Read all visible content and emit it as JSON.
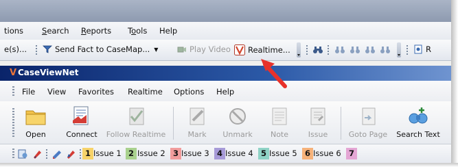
{
  "host": {
    "menu": [
      {
        "label": "tions",
        "u": ""
      },
      {
        "label": "Search",
        "u": "S"
      },
      {
        "label": "Reports",
        "u": "R"
      },
      {
        "label": "Tools",
        "u": "o"
      },
      {
        "label": "Help",
        "u": ""
      }
    ],
    "toolbar": {
      "cut_left": "e(s)...",
      "send_fact": "Send Fact to CaseMap...",
      "play_video": "Play Video",
      "realtime": "Realtime...",
      "cut_right": "R"
    }
  },
  "app": {
    "title": "CaseViewNet",
    "menu": [
      "File",
      "View",
      "Favorites",
      "Realtime",
      "Options",
      "Help"
    ],
    "toolbar": [
      {
        "id": "open",
        "label": "Open",
        "icon": "folder-icon",
        "enabled": true
      },
      {
        "id": "connect",
        "label": "Connect",
        "icon": "connect-icon",
        "enabled": true
      },
      {
        "id": "follow",
        "label": "Follow Realtime",
        "icon": "follow-icon",
        "enabled": false
      },
      {
        "id": "mark",
        "label": "Mark",
        "icon": "mark-icon",
        "enabled": false
      },
      {
        "id": "unmark",
        "label": "Unmark",
        "icon": "unmark-icon",
        "enabled": false
      },
      {
        "id": "note",
        "label": "Note",
        "icon": "note-icon",
        "enabled": false
      },
      {
        "id": "issue",
        "label": "Issue",
        "icon": "issue-icon",
        "enabled": false
      },
      {
        "id": "gotopage",
        "label": "Goto Page",
        "icon": "goto-page-icon",
        "enabled": false
      },
      {
        "id": "searchtext",
        "label": "Search Text",
        "icon": "search-text-icon",
        "enabled": true
      }
    ],
    "issues": [
      {
        "num": "1",
        "label": "Issue 1",
        "color": "#f7d36a"
      },
      {
        "num": "2",
        "label": "Issue 2",
        "color": "#a9d18e"
      },
      {
        "num": "3",
        "label": "Issue 3",
        "color": "#f19c9c"
      },
      {
        "num": "4",
        "label": "Issue 4",
        "color": "#a79bd8"
      },
      {
        "num": "5",
        "label": "Issue 5",
        "color": "#8fd3c6"
      },
      {
        "num": "6",
        "label": "Issue 6",
        "color": "#f6b27a"
      },
      {
        "num": "7",
        "label": "",
        "color": "#e4a6d4"
      }
    ]
  },
  "colors": {
    "annotation_arrow": "#e8312a",
    "title_gradient_start": "#0a246a",
    "title_gradient_end": "#6f94d0"
  }
}
